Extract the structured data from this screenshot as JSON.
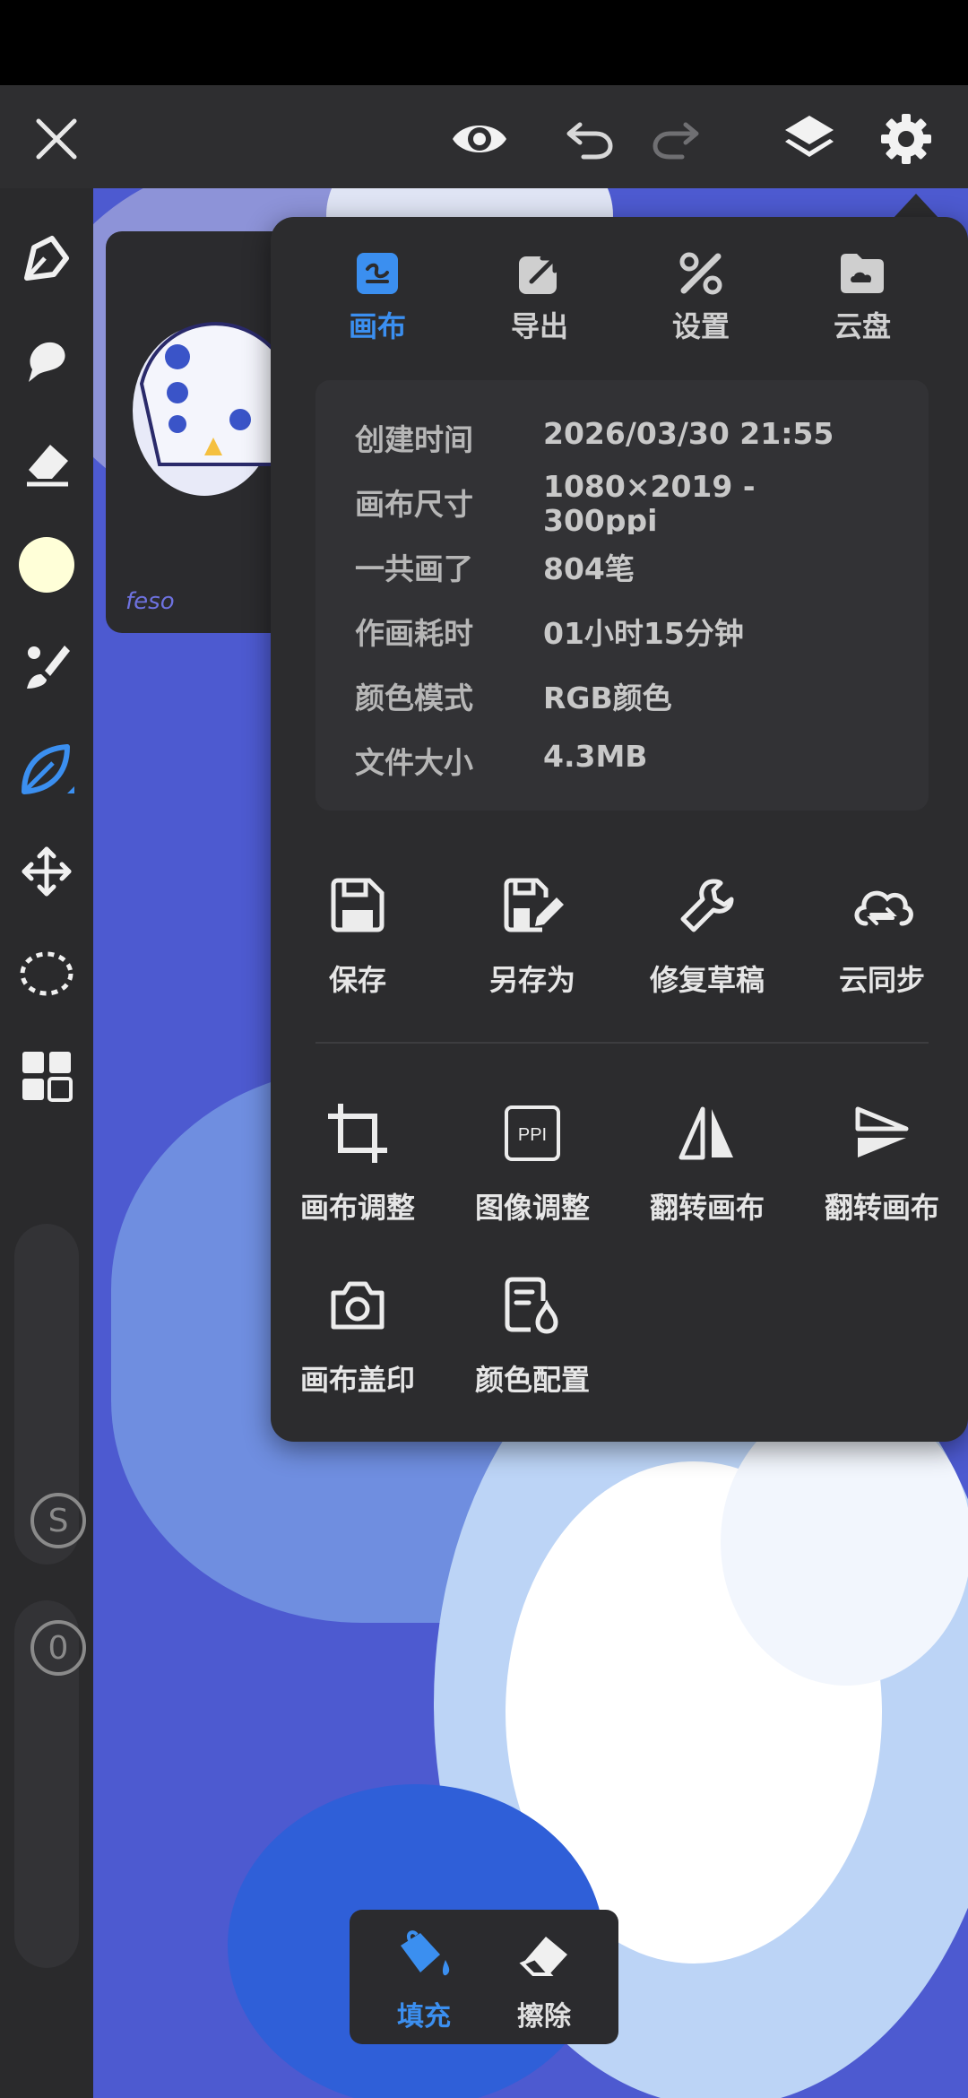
{
  "toolbar": {
    "icons": [
      "close-icon",
      "eye-icon",
      "undo-icon",
      "redo-icon",
      "layers-icon",
      "gear-icon"
    ]
  },
  "sidebar": {
    "brush_color": "#ffffd8",
    "slider_s_label": "S",
    "slider_o_label": "0"
  },
  "thumbnail": {
    "caption": "feso"
  },
  "popup": {
    "tabs": [
      {
        "label": "画布",
        "icon": "canvas-icon",
        "active": true
      },
      {
        "label": "导出",
        "icon": "export-icon",
        "active": false
      },
      {
        "label": "设置",
        "icon": "tools-icon",
        "active": false
      },
      {
        "label": "云盘",
        "icon": "cloud-folder-icon",
        "active": false
      }
    ],
    "info": [
      {
        "key": "创建时间",
        "value": "2026/03/30  21:55"
      },
      {
        "key": "画布尺寸",
        "value": "1080×2019  -",
        "value2": "300ppi"
      },
      {
        "key": "一共画了",
        "value": "804笔"
      },
      {
        "key": "作画耗时",
        "value": "01小时15分钟"
      },
      {
        "key": "颜色模式",
        "value": "RGB颜色"
      },
      {
        "key": "文件大小",
        "value": "4.3MB"
      }
    ],
    "actions_row1": [
      {
        "label": "保存",
        "icon": "save-icon"
      },
      {
        "label": "另存为",
        "icon": "save-as-icon"
      },
      {
        "label": "修复草稿",
        "icon": "wrench-icon"
      },
      {
        "label": "云同步",
        "icon": "cloud-sync-icon"
      }
    ],
    "actions_row2": [
      {
        "label": "画布调整",
        "icon": "crop-icon"
      },
      {
        "label": "图像调整",
        "icon": "ppi-icon",
        "icon_text": "PPI"
      },
      {
        "label": "翻转画布",
        "icon": "flip-horizontal-icon"
      },
      {
        "label": "翻转画布",
        "icon": "flip-vertical-icon"
      }
    ],
    "actions_row3": [
      {
        "label": "画布盖印",
        "icon": "camera-icon"
      },
      {
        "label": "颜色配置",
        "icon": "color-profile-icon"
      }
    ]
  },
  "bottom_tool": {
    "fill_label": "填充",
    "erase_label": "擦除"
  },
  "colors": {
    "accent": "#3b8ff0",
    "panel": "#2c2c2e",
    "canvas_blue": "#4d5ad0"
  }
}
